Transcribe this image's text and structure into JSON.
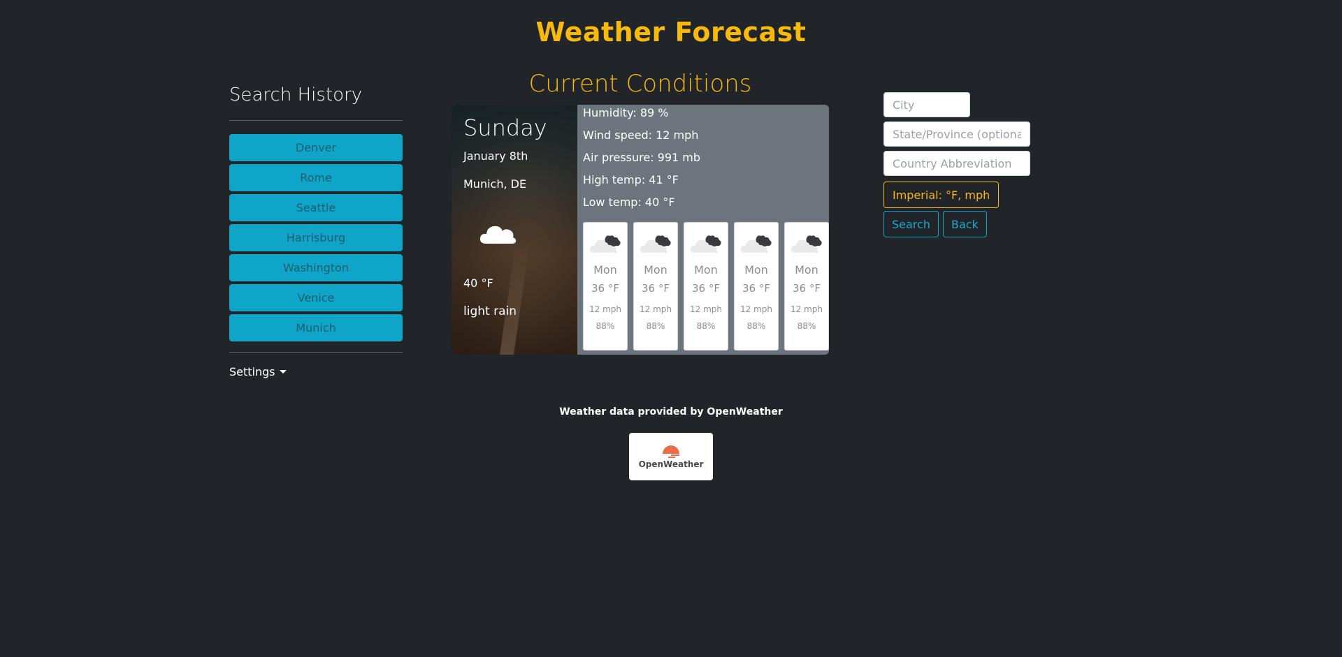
{
  "header": {
    "title": "Weather Forecast"
  },
  "sidebar": {
    "title": "Search History",
    "history": [
      "Denver",
      "Rome",
      "Seattle",
      "Harrisburg",
      "Washington",
      "Venice",
      "Munich"
    ],
    "settings_label": "Settings"
  },
  "current": {
    "section_title": "Current Conditions",
    "day": "Sunday",
    "date": "January 8th",
    "location": "Munich, DE",
    "temp": "40 °F",
    "description": "light rain",
    "icon": "cloud-icon",
    "humidity": "Humidity: 89 %",
    "wind": "Wind speed: 12 mph",
    "pressure": "Air pressure: 991 mb",
    "high": "High temp: 41 °F",
    "low": "Low temp: 40 °F"
  },
  "forecast": [
    {
      "day": "Mon",
      "temp": "36 °F",
      "wind": "12 mph",
      "humidity": "88%",
      "icon": "cloud-icon"
    },
    {
      "day": "Mon",
      "temp": "36 °F",
      "wind": "12 mph",
      "humidity": "88%",
      "icon": "cloud-icon"
    },
    {
      "day": "Mon",
      "temp": "36 °F",
      "wind": "12 mph",
      "humidity": "88%",
      "icon": "cloud-icon"
    },
    {
      "day": "Mon",
      "temp": "36 °F",
      "wind": "12 mph",
      "humidity": "88%",
      "icon": "cloud-icon"
    },
    {
      "day": "Mon",
      "temp": "36 °F",
      "wind": "12 mph",
      "humidity": "88%",
      "icon": "cloud-icon"
    }
  ],
  "form": {
    "city_placeholder": "City",
    "state_placeholder": "State/Province (optional)",
    "country_placeholder": "Country Abbreviation",
    "units_label": "Imperial: °F, mph",
    "search_label": "Search",
    "back_label": "Back"
  },
  "footer": {
    "attribution": "Weather data provided by OpenWeather",
    "logo_text": "OpenWeather"
  },
  "colors": {
    "background": "#212429",
    "accent": "#f8b90d",
    "history_button": "#0ea5c9",
    "card": "#6c757d",
    "logo_orange": "#eb6e4b"
  }
}
